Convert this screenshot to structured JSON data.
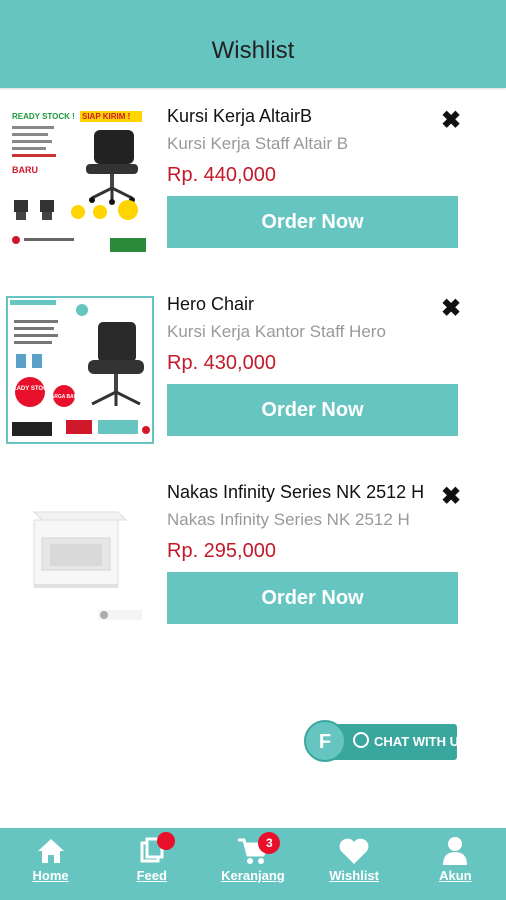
{
  "header": {
    "title": "Wishlist"
  },
  "items": [
    {
      "name": "Kursi Kerja AltairB",
      "subtitle": "Kursi Kerja Staff Altair B",
      "price": "Rp. 440,000",
      "order_label": "Order Now",
      "remove_glyph": "✖",
      "thumb": {
        "banner_left": "READY STOCK !",
        "banner_right": "SIAP KIRIM !",
        "badge": "BARU"
      }
    },
    {
      "name": "Hero Chair",
      "subtitle": "Kursi Kerja Kantor Staff Hero",
      "price": "Rp. 430,000",
      "order_label": "Order Now",
      "remove_glyph": "✖",
      "thumb": {
        "badge1": "READY STOCK",
        "badge2": "HARGA BARU"
      }
    },
    {
      "name": "Nakas Infinity Series NK 2512 H",
      "subtitle": "Nakas Infinity Series NK 2512 H",
      "price": "Rp. 295,000",
      "order_label": "Order Now",
      "remove_glyph": "✖"
    }
  ],
  "chat": {
    "label": "CHAT WITH US"
  },
  "nav": [
    {
      "label": "Home",
      "icon": "home-icon"
    },
    {
      "label": "Feed",
      "icon": "feed-icon"
    },
    {
      "label": "Keranjang",
      "icon": "cart-icon",
      "badge": "3"
    },
    {
      "label": "Wishlist",
      "icon": "heart-icon"
    },
    {
      "label": "Akun",
      "icon": "user-icon"
    }
  ],
  "colors": {
    "primary": "#66c5c0",
    "price": "#c3192a",
    "badge": "#e8102a"
  }
}
